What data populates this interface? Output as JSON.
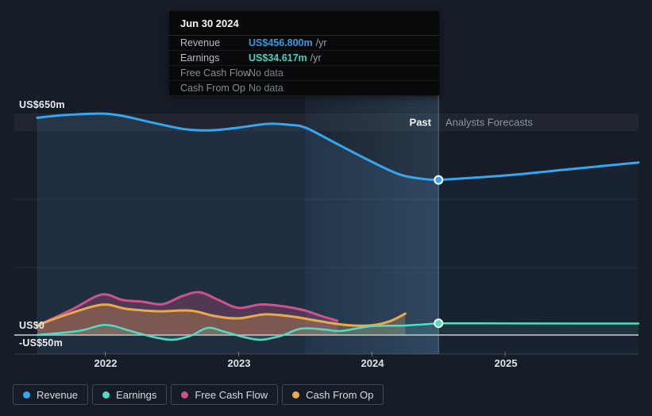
{
  "colors": {
    "background": "#171d27",
    "revenue": "#38a5f1",
    "earnings": "#52dcc6",
    "free_cash_flow": "#c9548e",
    "cash_from_op": "#e8aa4c",
    "revenue_fill_past": "rgba(74,144,200,0.16)",
    "revenue_fill_forecast": "rgba(74,144,200,0.05)",
    "band_fill_left": "rgba(110,178,235,0.05)",
    "band_fill_right": "rgba(132,196,250,0.17)",
    "fcf_fill": "rgba(199,79,136,0.30)",
    "cashop_fill": "rgba(224,162,74,0.30)",
    "earnings_fill": "rgba(100,220,198,0.15)",
    "earnings_fill_forecast": "rgba(100,220,198,0.10)",
    "zero_line": "#b4bcc4",
    "axis_line": "rgba(255,255,255,0.15)",
    "grid_line": "rgba(255,255,255,0.08)",
    "strip_fill": "rgba(255,255,255,0.04)",
    "strip_line_top": "rgba(255,255,255,0.10)",
    "strip_line_bottom": "rgba(255,255,255,0.08)",
    "divider": "rgba(150,200,240,0.45)",
    "data_start_line": "rgba(255,255,255,0.05)",
    "tick_mark": "rgba(255,255,255,0.35)",
    "tooltip_value_revenue": "#2e9fe3",
    "tooltip_value_earnings": "#40d4c4",
    "tooltip_no_data": "#7b828b"
  },
  "tooltip": {
    "date": "Jun 30 2024",
    "rows": [
      {
        "label": "Revenue",
        "value": "US$456.800m",
        "suffix": "/yr",
        "color_key": "tooltip_value_revenue",
        "dim": false
      },
      {
        "label": "Earnings",
        "value": "US$34.617m",
        "suffix": "/yr",
        "color_key": "tooltip_value_earnings",
        "dim": false
      },
      {
        "label": "Free Cash Flow",
        "value": "No data",
        "suffix": "",
        "color_key": "tooltip_no_data",
        "dim": true
      },
      {
        "label": "Cash From Op",
        "value": "No data",
        "suffix": "",
        "color_key": "tooltip_no_data",
        "dim": true
      }
    ]
  },
  "y_axis": {
    "top": "US$650m",
    "zero": "US$0",
    "neg": "-US$50m"
  },
  "x_axis": {
    "ticks": [
      "2022",
      "2023",
      "2024",
      "2025"
    ],
    "tick_years": [
      2022,
      2023,
      2024,
      2025
    ]
  },
  "header": {
    "past": "Past",
    "forecast": "Analysts Forecasts"
  },
  "legend": [
    {
      "label": "Revenue",
      "color_key": "revenue"
    },
    {
      "label": "Earnings",
      "color_key": "earnings"
    },
    {
      "label": "Free Cash Flow",
      "color_key": "free_cash_flow"
    },
    {
      "label": "Cash From Op",
      "color_key": "cash_from_op"
    }
  ],
  "chart_data": {
    "type": "line",
    "unit": "US$ millions per year",
    "x_range": [
      2021.49,
      2026.0
    ],
    "y_range": [
      -56,
      650
    ],
    "past_forecast_boundary": 2024.5,
    "highlight_period": [
      2023.5,
      2024.5
    ],
    "grid": "horizontal-sparse",
    "legend_position": "bottom-left",
    "series": [
      {
        "name": "Revenue",
        "segment": "past",
        "color_key": "revenue",
        "points": [
          [
            2021.49,
            640
          ],
          [
            2021.7,
            648
          ],
          [
            2021.95,
            652
          ],
          [
            2022.05,
            650
          ],
          [
            2022.15,
            644
          ],
          [
            2022.35,
            626
          ],
          [
            2022.6,
            606
          ],
          [
            2022.8,
            603
          ],
          [
            2023.0,
            611
          ],
          [
            2023.22,
            622
          ],
          [
            2023.38,
            619
          ],
          [
            2023.5,
            611
          ],
          [
            2023.7,
            571
          ],
          [
            2023.95,
            520
          ],
          [
            2024.2,
            474
          ],
          [
            2024.38,
            460
          ],
          [
            2024.5,
            456.8
          ]
        ]
      },
      {
        "name": "Revenue",
        "segment": "forecast",
        "color_key": "revenue",
        "points": [
          [
            2024.5,
            456.8
          ],
          [
            2025.0,
            470
          ],
          [
            2025.5,
            489
          ],
          [
            2026.0,
            508
          ]
        ]
      },
      {
        "name": "Earnings",
        "segment": "past",
        "color_key": "earnings",
        "points": [
          [
            2021.49,
            0
          ],
          [
            2021.8,
            12
          ],
          [
            2022.0,
            30
          ],
          [
            2022.18,
            13
          ],
          [
            2022.35,
            -5
          ],
          [
            2022.5,
            -14
          ],
          [
            2022.64,
            -2
          ],
          [
            2022.77,
            21
          ],
          [
            2022.9,
            9
          ],
          [
            2023.05,
            -7
          ],
          [
            2023.17,
            -14
          ],
          [
            2023.32,
            -2
          ],
          [
            2023.47,
            19
          ],
          [
            2023.65,
            16
          ],
          [
            2023.77,
            12
          ],
          [
            2024.0,
            26
          ],
          [
            2024.25,
            28
          ],
          [
            2024.5,
            34.617
          ]
        ]
      },
      {
        "name": "Earnings",
        "segment": "forecast",
        "color_key": "earnings",
        "points": [
          [
            2024.5,
            34.617
          ],
          [
            2025.0,
            34.2
          ],
          [
            2025.5,
            33.8
          ],
          [
            2026.0,
            33.8
          ]
        ]
      },
      {
        "name": "Free Cash Flow",
        "segment": "past",
        "color_key": "free_cash_flow",
        "points": [
          [
            2021.49,
            28
          ],
          [
            2021.75,
            75
          ],
          [
            2021.97,
            119
          ],
          [
            2022.13,
            103
          ],
          [
            2022.28,
            98
          ],
          [
            2022.43,
            91
          ],
          [
            2022.58,
            115
          ],
          [
            2022.71,
            126
          ],
          [
            2022.85,
            103
          ],
          [
            2023.0,
            80
          ],
          [
            2023.17,
            90
          ],
          [
            2023.35,
            84
          ],
          [
            2023.5,
            72
          ],
          [
            2023.62,
            56
          ],
          [
            2023.74,
            42
          ]
        ]
      },
      {
        "name": "Cash From Op",
        "segment": "past",
        "color_key": "cash_from_op",
        "points": [
          [
            2021.49,
            28
          ],
          [
            2021.68,
            56
          ],
          [
            2021.97,
            89
          ],
          [
            2022.16,
            77
          ],
          [
            2022.4,
            70
          ],
          [
            2022.64,
            72
          ],
          [
            2022.82,
            56
          ],
          [
            2023.0,
            49
          ],
          [
            2023.2,
            61
          ],
          [
            2023.41,
            54
          ],
          [
            2023.59,
            42
          ],
          [
            2023.8,
            30
          ],
          [
            2023.98,
            28
          ],
          [
            2024.13,
            40
          ],
          [
            2024.25,
            63
          ]
        ]
      }
    ],
    "markers": [
      {
        "series": "Revenue",
        "x": 2024.5,
        "y": 456.8
      },
      {
        "series": "Earnings",
        "x": 2024.5,
        "y": 34.617
      }
    ]
  }
}
